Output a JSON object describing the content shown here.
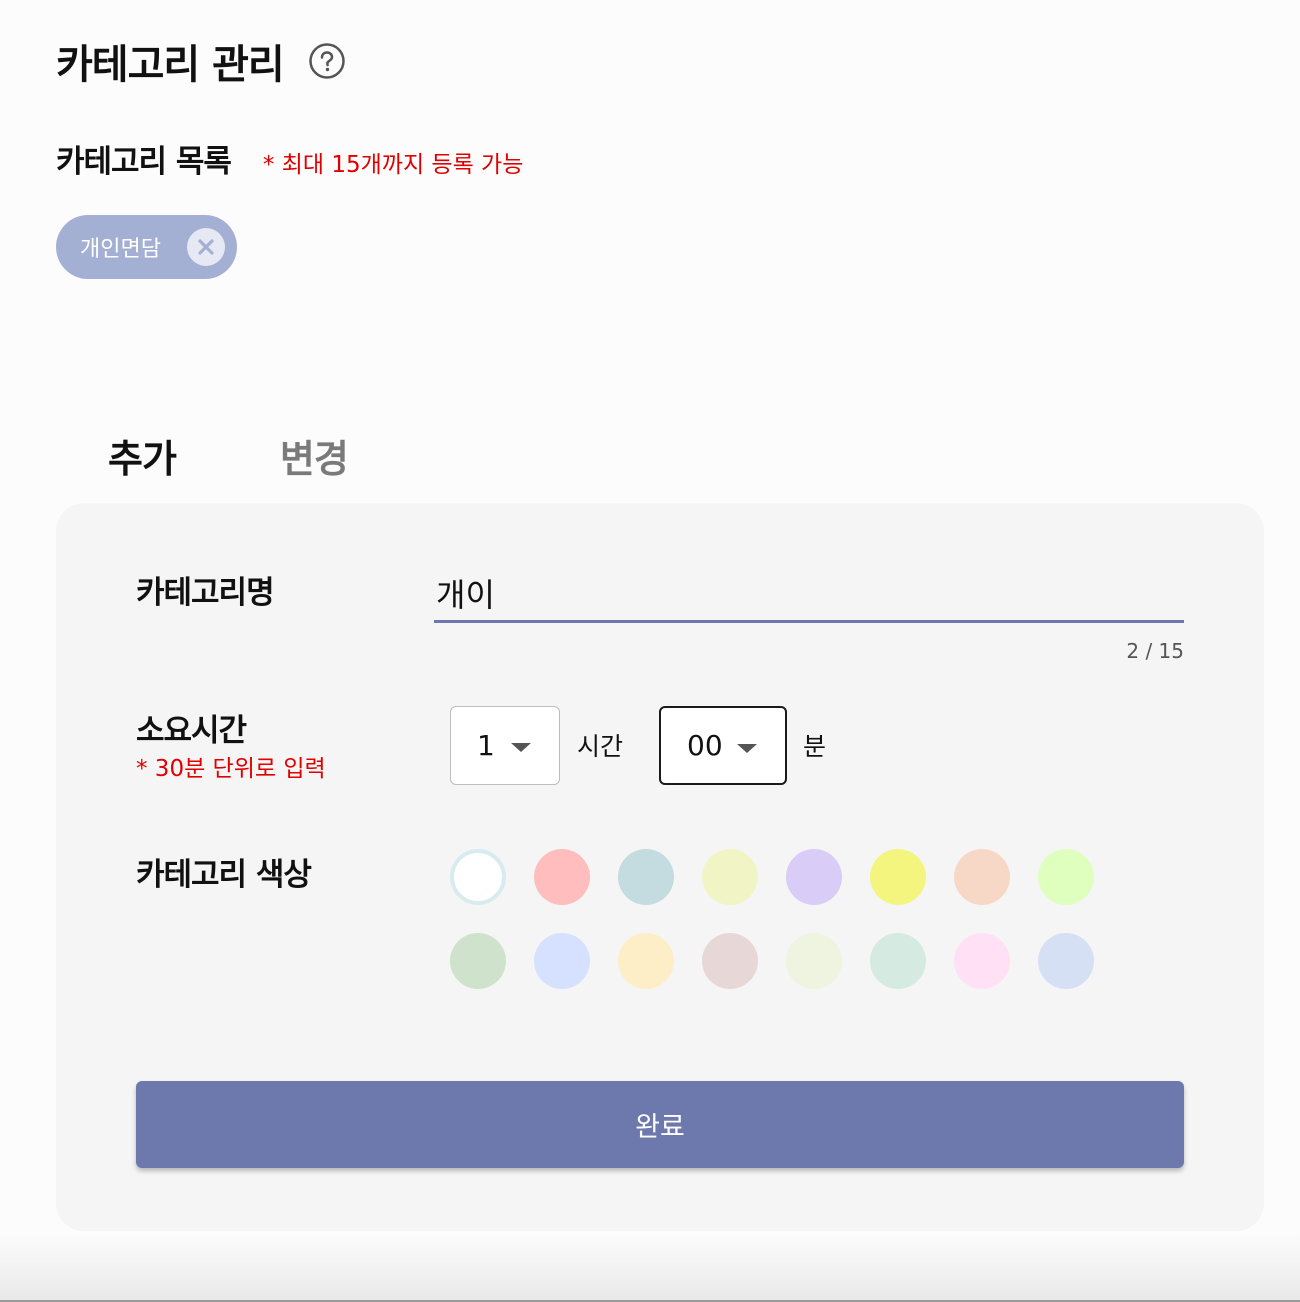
{
  "header": {
    "title": "카테고리 관리",
    "help_icon": "question-circle-icon"
  },
  "category_list": {
    "title": "카테고리 목록",
    "note": "* 최대 15개까지 등록 가능",
    "chips": [
      {
        "label": "개인면담",
        "color": "#a4b0d3",
        "close_icon": "close-icon"
      }
    ]
  },
  "tabs": [
    {
      "label": "추가",
      "active": true
    },
    {
      "label": "변경",
      "active": false
    }
  ],
  "form": {
    "name_label": "카테고리명",
    "name_value": "개이",
    "name_counter": "2 / 15",
    "duration_label": "소요시간",
    "duration_note": "* 30분 단위로 입력",
    "hour_value": "1",
    "hour_unit": "시간",
    "minute_value": "00",
    "minute_unit": "분",
    "color_label": "카테고리 색상",
    "colors": [
      "#ffffff",
      "#ffbdbd",
      "#c4dbe0",
      "#f1f5c6",
      "#d9ccf7",
      "#f3f57e",
      "#f7d8c6",
      "#deffbd",
      "#cfe3cc",
      "#d6e0ff",
      "#fdeec7",
      "#e8d7d7",
      "#eef4e0",
      "#d5ebe2",
      "#ffe0f5",
      "#d6e0f5"
    ],
    "selected_color_index": 0,
    "submit_label": "완료"
  },
  "theme": {
    "accent": "#6d79ad",
    "warning": "#e00000"
  }
}
